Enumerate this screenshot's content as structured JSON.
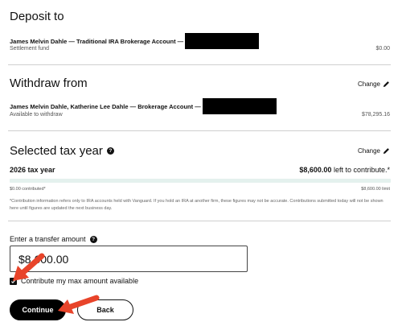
{
  "deposit": {
    "title": "Deposit to",
    "account": "James Melvin Dahle — Traditional IRA Brokerage Account —",
    "sub_label": "Settlement fund",
    "sub_value": "$0.00"
  },
  "withdraw": {
    "title": "Withdraw from",
    "change_label": "Change",
    "account": "James Melvin Dahle, Katherine Lee Dahle — Brokerage Account —",
    "sub_label": "Available to withdraw",
    "sub_value": "$78,295.16"
  },
  "tax": {
    "title": "Selected tax year",
    "change_label": "Change",
    "year_label": "2026 tax year",
    "remaining_amount": "$8,600.00",
    "remaining_suffix": "left to contribute.*",
    "contributed_label": "$0.00 contributed*",
    "limit_label": "$8,600.00 limit",
    "contributed_fraction": 0.0,
    "disclaimer": "*Contribution information refers only to IRA accounts held with Vanguard. If you hold an IRA at another firm, these figures may not be accurate. Contributions submitted today will not be shown here until figures are updated the next business day."
  },
  "transfer": {
    "label": "Enter a transfer amount",
    "value": "$8,600.00",
    "max_label": "Contribute my max amount available",
    "max_checked": true
  },
  "buttons": {
    "continue": "Continue",
    "back": "Back"
  },
  "colors": {
    "annotation_arrow": "#e8442a",
    "progress_track": "#e4f1ee"
  }
}
